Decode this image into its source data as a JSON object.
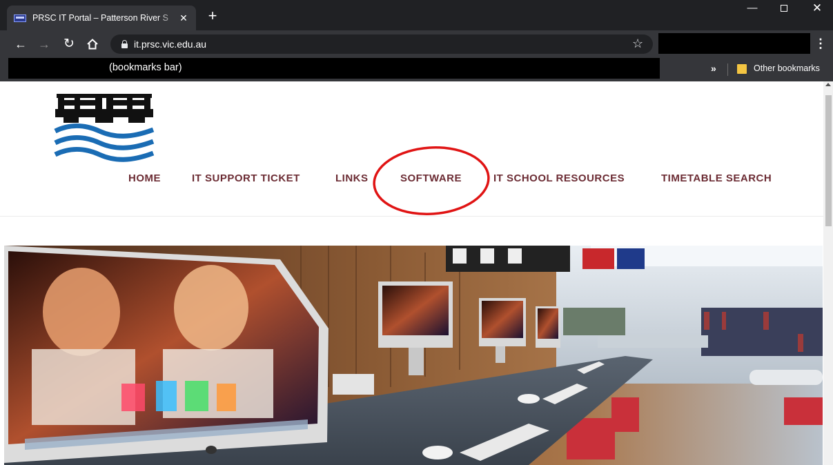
{
  "browser": {
    "tab": {
      "title": "PRSC IT Portal – Patterson River S"
    },
    "address": {
      "url": "it.prsc.vic.edu.au"
    },
    "bookmarks": {
      "bar_label": "(bookmarks bar)",
      "overflow": "»",
      "other_bookmarks": "Other bookmarks"
    },
    "icons": [
      "back-arrow-icon",
      "forward-arrow-icon",
      "reload-icon",
      "home-icon",
      "lock-icon",
      "star-icon",
      "menu-icon",
      "folder-icon",
      "close-icon",
      "plus-icon"
    ]
  },
  "site": {
    "nav": {
      "items": [
        {
          "label": "HOME"
        },
        {
          "label": "IT SUPPORT TICKET"
        },
        {
          "label": "LINKS"
        },
        {
          "label": "SOFTWARE",
          "highlighted": true
        },
        {
          "label": "IT SCHOOL RESOURCES"
        },
        {
          "label": "TIMETABLE SEARCH"
        }
      ]
    },
    "colors": {
      "nav_text": "#6b2b33",
      "highlight": "#e01414",
      "logo_blue": "#1a6cb4",
      "logo_black": "#111111"
    }
  }
}
